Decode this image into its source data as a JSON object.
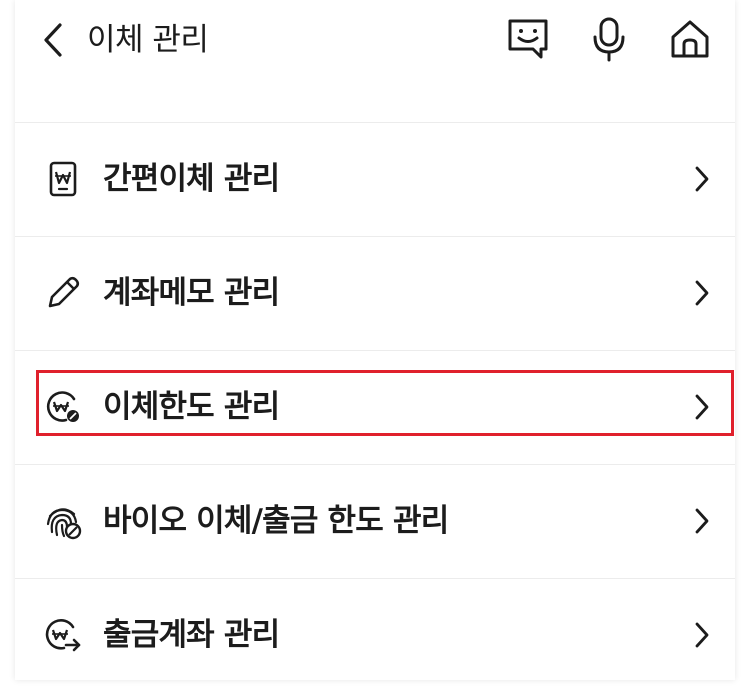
{
  "header": {
    "title": "이체 관리",
    "icons": [
      "back-icon",
      "chat-bot-icon",
      "microphone-icon",
      "home-icon"
    ]
  },
  "menu": {
    "items": [
      {
        "label": "간편이체 관리",
        "icon": "simple-transfer-card-icon"
      },
      {
        "label": "계좌메모 관리",
        "icon": "pencil-icon"
      },
      {
        "label": "이체한도 관리",
        "icon": "transfer-limit-icon"
      },
      {
        "label": "바이오 이체/출금 한도 관리",
        "icon": "fingerprint-limit-icon"
      },
      {
        "label": "출금계좌 관리",
        "icon": "withdrawal-account-icon"
      }
    ]
  },
  "highlight": {
    "item": "이체한도 관리",
    "color": "#e0202c"
  }
}
